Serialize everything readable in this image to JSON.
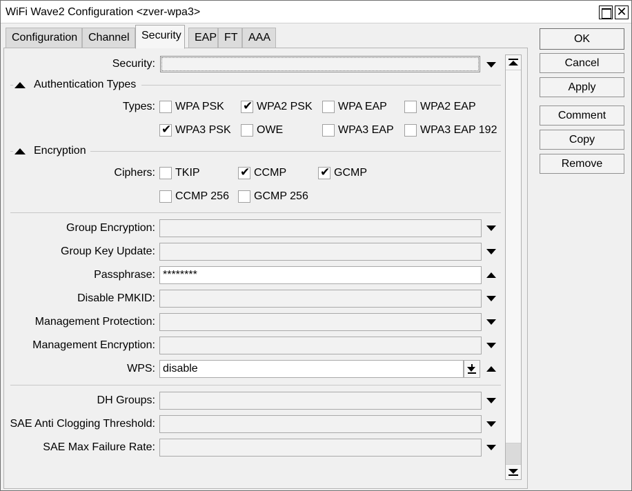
{
  "window": {
    "title": "WiFi Wave2 Configuration <zver-wpa3>"
  },
  "tabs": [
    {
      "label": "Configuration",
      "active": false
    },
    {
      "label": "Channel",
      "active": false
    },
    {
      "label": "Security",
      "active": true
    },
    {
      "label": "EAP",
      "active": false
    },
    {
      "label": "FT",
      "active": false
    },
    {
      "label": "AAA",
      "active": false
    }
  ],
  "security": {
    "label": "Security:",
    "value": ""
  },
  "auth_types": {
    "section_title": "Authentication Types",
    "label": "Types:",
    "options": [
      {
        "label": "WPA PSK",
        "checked": false
      },
      {
        "label": "WPA2 PSK",
        "checked": true
      },
      {
        "label": "WPA EAP",
        "checked": false
      },
      {
        "label": "WPA2 EAP",
        "checked": false
      },
      {
        "label": "WPA3 PSK",
        "checked": true
      },
      {
        "label": "OWE",
        "checked": false
      },
      {
        "label": "WPA3 EAP",
        "checked": false
      },
      {
        "label": "WPA3 EAP 192",
        "checked": false
      }
    ]
  },
  "encryption": {
    "section_title": "Encryption",
    "label": "Ciphers:",
    "options": [
      {
        "label": "TKIP",
        "checked": false
      },
      {
        "label": "CCMP",
        "checked": true
      },
      {
        "label": "GCMP",
        "checked": true
      },
      {
        "label": "CCMP 256",
        "checked": false
      },
      {
        "label": "GCMP 256",
        "checked": false
      }
    ]
  },
  "fields": [
    {
      "label": "Group Encryption:",
      "value": "",
      "control": "down"
    },
    {
      "label": "Group Key Update:",
      "value": "",
      "control": "down"
    },
    {
      "label": "Passphrase:",
      "value": "********",
      "control": "up"
    },
    {
      "label": "Disable PMKID:",
      "value": "",
      "control": "down"
    },
    {
      "label": "Management Protection:",
      "value": "",
      "control": "down"
    },
    {
      "label": "Management Encryption:",
      "value": "",
      "control": "down"
    },
    {
      "label": "WPS:",
      "value": "disable",
      "control": "up"
    }
  ],
  "sae_fields": [
    {
      "label": "DH Groups:",
      "value": "",
      "control": "down"
    },
    {
      "label": "SAE Anti Clogging Threshold:",
      "value": "",
      "control": "down"
    },
    {
      "label": "SAE Max Failure Rate:",
      "value": "",
      "control": "down"
    }
  ],
  "buttons": {
    "ok": "OK",
    "cancel": "Cancel",
    "apply": "Apply",
    "comment": "Comment",
    "copy": "Copy",
    "remove": "Remove"
  },
  "icons": {
    "check": "✔",
    "close": "✕"
  }
}
